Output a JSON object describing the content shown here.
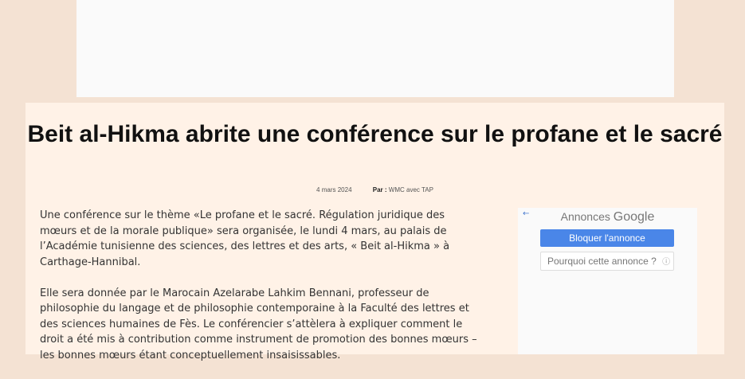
{
  "article": {
    "title": "Beit al-Hikma abrite une conférence sur le profane et le sacré",
    "date": "4 mars 2024",
    "by_label": "Par :",
    "author": "WMC avec TAP",
    "paragraphs": [
      "Une conférence sur le thème «Le profane et le sacré. Régulation juridique des mœurs et de la morale publique» sera organisée, le lundi 4 mars, au palais de l’Académie tunisienne des sciences, des lettres et des arts, « Beit al-Hikma » à Carthage-Hannibal.",
      "Elle sera donnée par le Marocain Azelarabe Lahkim Bennani, professeur de philosophie du langage et de philosophie contemporaine à la Faculté des lettres et des sciences humaines de Fès. Le conférencier s’attèlera à expliquer comment le droit a été mis à contribution comme instrument de promotion des bonnes mœurs – les bonnes mœurs étant conceptuellement insaisissables."
    ]
  },
  "ad": {
    "back_icon": "←",
    "annonces_label": "Annonces",
    "google_label": "Google",
    "block_label": "Bloquer l'annonce",
    "why_label": "Pourquoi cette annonce ?",
    "info_icon": "ⓘ"
  }
}
